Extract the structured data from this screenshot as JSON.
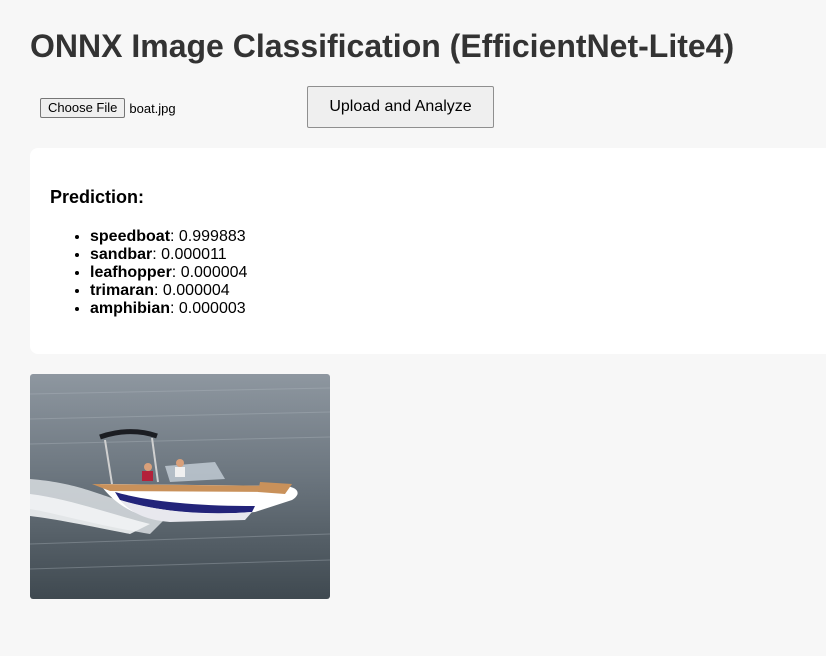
{
  "page": {
    "title": "ONNX Image Classification (EfficientNet-Lite4)"
  },
  "upload": {
    "choose_file_label": "Choose File",
    "file_name": "boat.jpg",
    "submit_label": "Upload and Analyze"
  },
  "result": {
    "heading": "Prediction:",
    "predictions": [
      {
        "label": "speedboat",
        "score": ": 0.999883"
      },
      {
        "label": "sandbar",
        "score": ": 0.000011"
      },
      {
        "label": "leafhopper",
        "score": ": 0.000004"
      },
      {
        "label": "trimaran",
        "score": ": 0.000004"
      },
      {
        "label": "amphibian",
        "score": ": 0.000003"
      }
    ]
  },
  "colors": {
    "background": "#f7f7f7",
    "card": "#ffffff",
    "title": "#333333"
  }
}
